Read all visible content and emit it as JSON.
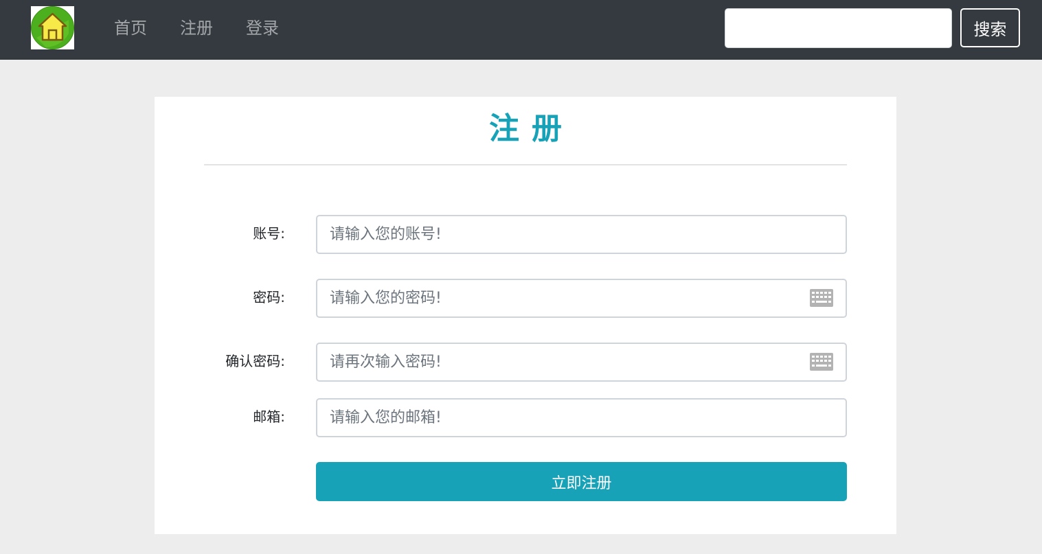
{
  "navbar": {
    "logo_icon": "house-icon",
    "links": [
      {
        "label": "首页"
      },
      {
        "label": "注册"
      },
      {
        "label": "登录"
      }
    ],
    "search": {
      "value": "",
      "placeholder": ""
    },
    "search_label": "搜索"
  },
  "form": {
    "title": "注册",
    "fields": [
      {
        "label": "账号:",
        "placeholder": "请输入您的账号!",
        "value": ""
      },
      {
        "label": "密码:",
        "placeholder": "请输入您的密码!",
        "value": "",
        "icon": "keyboard-icon"
      },
      {
        "label": "确认密码:",
        "placeholder": "请再次输入密码!",
        "value": "",
        "icon": "keyboard-icon"
      },
      {
        "label": "邮箱:",
        "placeholder": "请输入您的邮箱!",
        "value": ""
      }
    ],
    "submit_label": "立即注册"
  },
  "colors": {
    "navbar_bg": "#343a40",
    "accent": "#17a2b8",
    "page_bg": "#ededed"
  }
}
